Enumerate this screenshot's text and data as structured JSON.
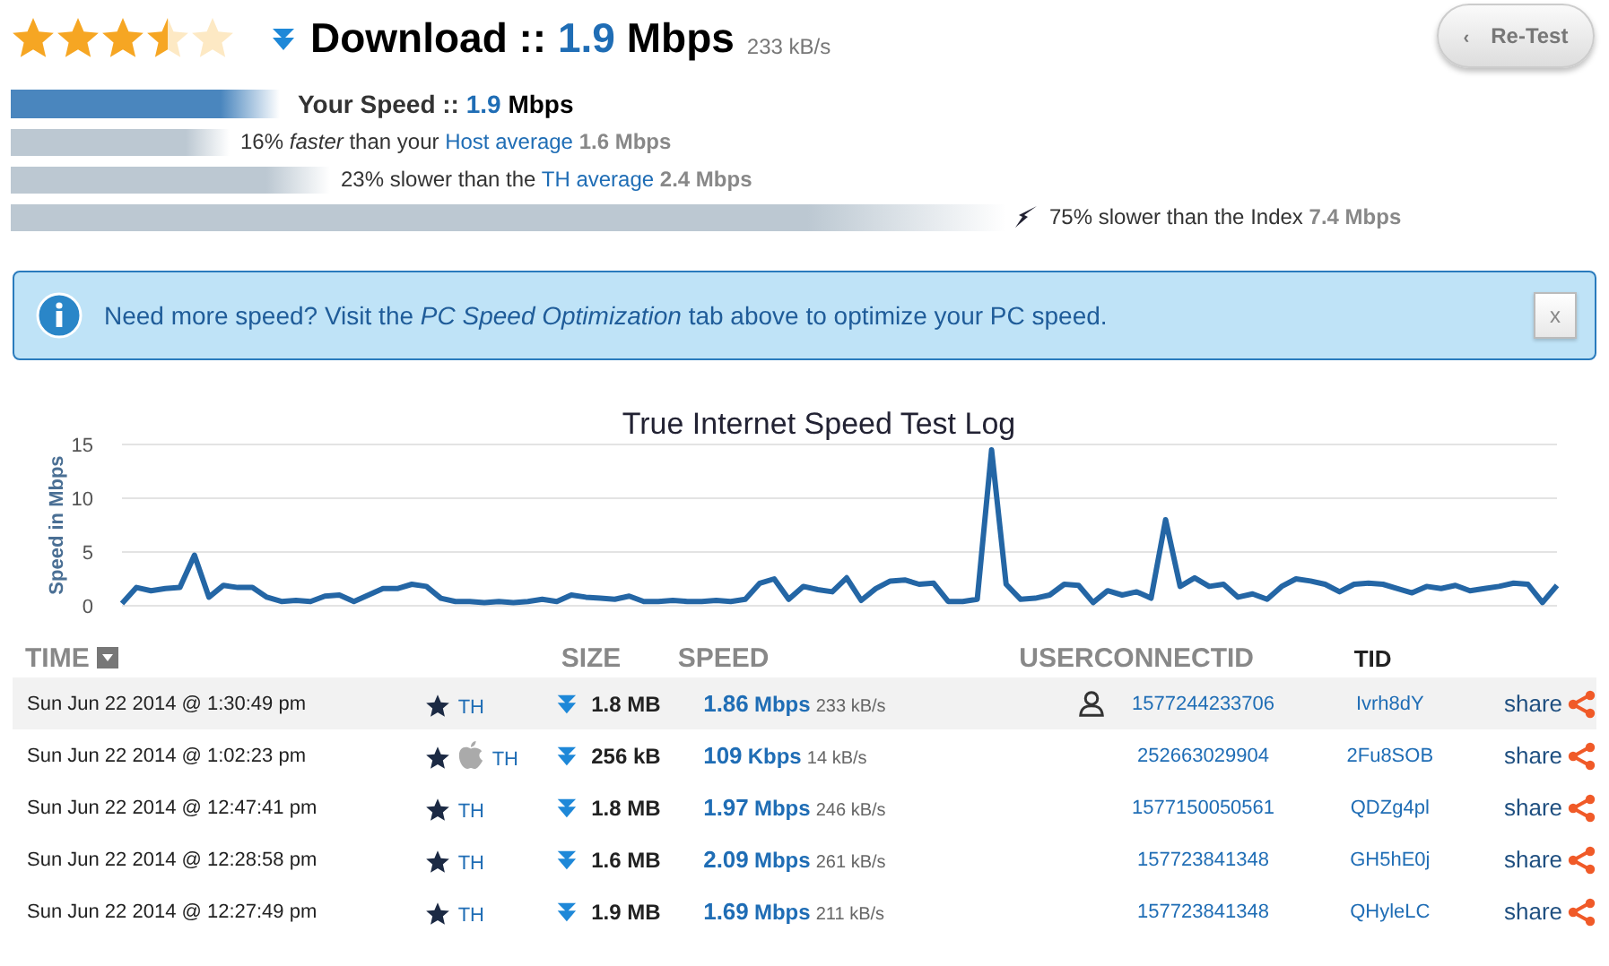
{
  "rating": {
    "stars": 3.5
  },
  "download": {
    "label": "Download ::",
    "value": "1.9",
    "unit": "Mbps",
    "rate": "233 kB/s"
  },
  "retest_button": {
    "caret": "‹",
    "label": "Re-Test"
  },
  "comparisons": [
    {
      "kind": "own",
      "label": "Your Speed ::",
      "value": "1.9",
      "unit": "Mbps"
    },
    {
      "kind": "compare",
      "text": "16% *faster* than your",
      "link": "Host average",
      "value": "1.6 Mbps"
    },
    {
      "kind": "compare",
      "text": "23% slower than the",
      "link": "TH average",
      "value": "2.4 Mbps"
    },
    {
      "kind": "index",
      "text": "75% slower than the Index",
      "value": "7.4 Mbps"
    }
  ],
  "notice": {
    "text": "Need more speed? Visit the *PC Speed Optimization* tab above to optimize your PC speed.",
    "close": "x"
  },
  "chart": {
    "chart_data": {
      "type": "line",
      "title": "True Internet Speed Test Log",
      "ylabel": "Speed in Mbps",
      "ylim": [
        0,
        15
      ],
      "yticks": [
        0,
        5,
        10,
        15
      ],
      "series": [
        {
          "color": "#2466a5",
          "values": [
            0.2,
            1.7,
            1.4,
            1.6,
            1.7,
            4.7,
            0.8,
            1.9,
            1.7,
            1.7,
            0.8,
            0.4,
            0.5,
            0.4,
            0.9,
            1.0,
            0.4,
            1.0,
            1.6,
            1.6,
            2.0,
            1.8,
            0.7,
            0.4,
            0.4,
            0.3,
            0.4,
            0.3,
            0.4,
            0.6,
            0.4,
            1.0,
            0.8,
            0.7,
            0.6,
            0.9,
            0.4,
            0.4,
            0.5,
            0.4,
            0.4,
            0.5,
            0.4,
            0.6,
            2.1,
            2.5,
            0.6,
            1.8,
            1.5,
            1.3,
            2.6,
            0.5,
            1.6,
            2.3,
            2.4,
            2.0,
            2.1,
            0.4,
            0.4,
            0.6,
            14.5,
            2.0,
            0.6,
            0.7,
            1.0,
            2.0,
            1.9,
            0.3,
            1.4,
            1.0,
            1.3,
            0.7,
            8.0,
            1.8,
            2.6,
            1.8,
            2.0,
            0.8,
            1.1,
            0.6,
            1.8,
            2.5,
            2.3,
            2.0,
            1.3,
            2.0,
            2.1,
            2.0,
            1.6,
            1.2,
            1.8,
            1.6,
            1.9,
            1.4,
            1.6,
            1.8,
            2.1,
            2.0,
            0.3,
            1.9
          ]
        }
      ]
    }
  },
  "table": {
    "columns": [
      "TIME",
      "SIZE",
      "SPEED",
      "USER",
      "CONNECTID",
      "TID"
    ],
    "rows": [
      {
        "selected": true,
        "time": "Sun Jun 22 2014 @ 1:30:49 pm",
        "apple": false,
        "country": "TH",
        "size": "1.8 MB",
        "speed": "1.86",
        "unit": "Mbps",
        "rate": "233 kB/s",
        "user_icon": true,
        "connectid": "1577244233706",
        "tid": "Ivrh8dY",
        "share": "share"
      },
      {
        "selected": false,
        "time": "Sun Jun 22 2014 @ 1:02:23 pm",
        "apple": true,
        "country": "TH",
        "size": "256 kB",
        "speed": "109",
        "unit": "Kbps",
        "rate": "14 kB/s",
        "user_icon": false,
        "connectid": "252663029904",
        "tid": "2Fu8SOB",
        "share": "share"
      },
      {
        "selected": false,
        "time": "Sun Jun 22 2014 @ 12:47:41 pm",
        "apple": false,
        "country": "TH",
        "size": "1.8 MB",
        "speed": "1.97",
        "unit": "Mbps",
        "rate": "246 kB/s",
        "user_icon": false,
        "connectid": "1577150050561",
        "tid": "QDZg4pl",
        "share": "share"
      },
      {
        "selected": false,
        "time": "Sun Jun 22 2014 @ 12:28:58 pm",
        "apple": false,
        "country": "TH",
        "size": "1.6 MB",
        "speed": "2.09",
        "unit": "Mbps",
        "rate": "261 kB/s",
        "user_icon": false,
        "connectid": "157723841348",
        "tid": "GH5hE0j",
        "share": "share"
      },
      {
        "selected": false,
        "time": "Sun Jun 22 2014 @ 12:27:49 pm",
        "apple": false,
        "country": "TH",
        "size": "1.9 MB",
        "speed": "1.69",
        "unit": "Mbps",
        "rate": "211 kB/s",
        "user_icon": false,
        "connectid": "157723841348",
        "tid": "QHyleLC",
        "share": "share"
      }
    ]
  }
}
